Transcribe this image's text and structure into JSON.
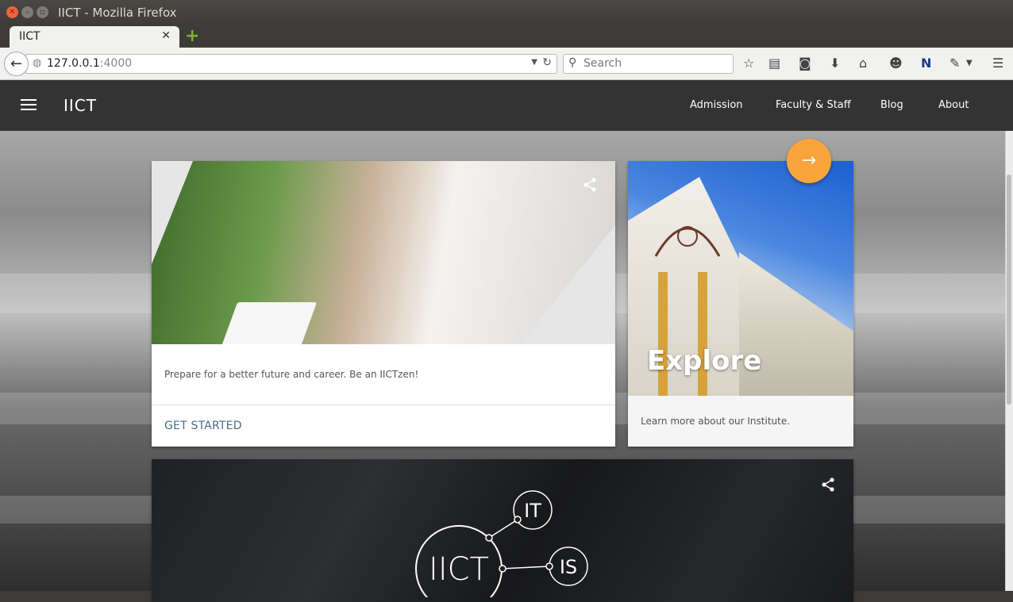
{
  "window": {
    "title": "IICT - Mozilla Firefox"
  },
  "tabs": [
    {
      "label": "IICT"
    }
  ],
  "address_bar": {
    "host": "127.0.0.1",
    "port": ":4000"
  },
  "search": {
    "placeholder": "Search"
  },
  "site": {
    "brand": "IICT",
    "nav": [
      "Admission",
      "Faculty & Staff",
      "Blog",
      "About"
    ]
  },
  "cards": {
    "main": {
      "description": "Prepare for a better future and career. Be an IICTzen!",
      "action": "GET STARTED"
    },
    "explore": {
      "title": "Explore",
      "description": "Learn more about our Institute."
    },
    "logo": {
      "center": "IICT",
      "node1": "IT",
      "node2": "IS"
    }
  },
  "colors": {
    "appbar": "#333333",
    "fab": "#f9a53b",
    "link": "#4b6a89"
  },
  "icons": [
    "back-arrow-icon",
    "globe-icon",
    "reload-icon",
    "search-icon",
    "bookmark-star-icon",
    "reading-list-icon",
    "pocket-icon",
    "download-icon",
    "home-icon",
    "chat-icon",
    "extension-n-icon",
    "extension-icon",
    "hamburger-menu-icon",
    "share-icon",
    "arrow-right-icon"
  ]
}
